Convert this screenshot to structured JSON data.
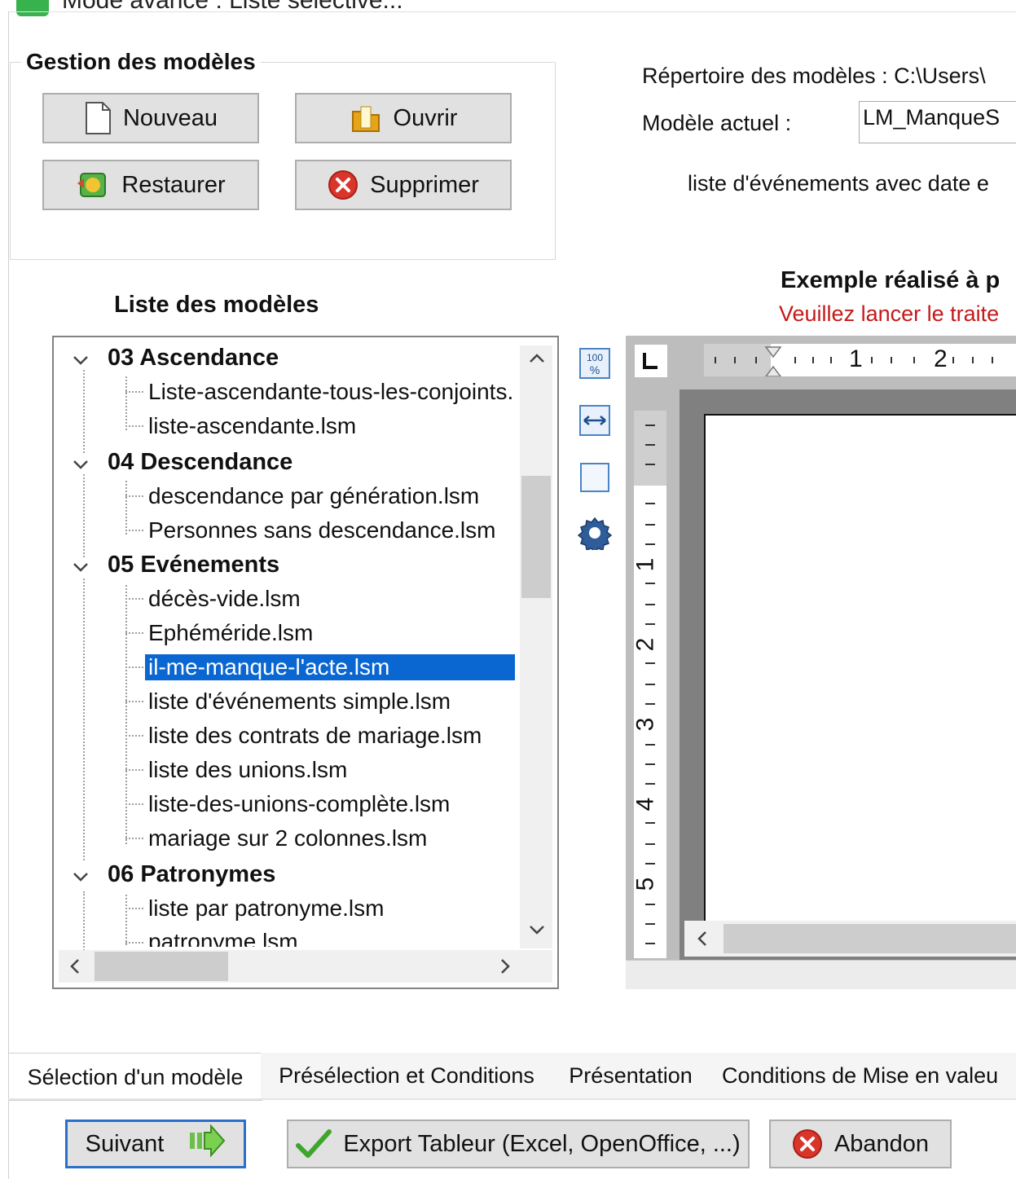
{
  "window": {
    "title": "Mode avancé : Liste sélective..."
  },
  "gestion": {
    "legend": "Gestion des modèles",
    "nouveau": "Nouveau",
    "ouvrir": "Ouvrir",
    "restaurer": "Restaurer",
    "supprimer": "Supprimer"
  },
  "info": {
    "repertoire_label": "Répertoire des modèles : C:\\Users\\",
    "modele_label": "Modèle actuel :",
    "modele_value": "LM_ManqueS",
    "description": "liste d'événements avec date e"
  },
  "exemple": {
    "title": "Exemple réalisé à p",
    "warning": "Veuillez lancer le traite"
  },
  "liste": {
    "title": "Liste des modèles",
    "groups": [
      {
        "label": "03 Ascendance",
        "items": [
          "Liste-ascendante-tous-les-conjoints.",
          "liste-ascendante.lsm"
        ]
      },
      {
        "label": "04 Descendance",
        "items": [
          "descendance par génération.lsm",
          "Personnes sans descendance.lsm"
        ]
      },
      {
        "label": "05 Evénements",
        "items": [
          "décès-vide.lsm",
          "Ephéméride.lsm",
          "il-me-manque-l'acte.lsm",
          "liste d'événements simple.lsm",
          "liste des contrats de mariage.lsm",
          "liste des unions.lsm",
          "liste-des-unions-complète.lsm",
          "mariage sur 2 colonnes.lsm"
        ]
      },
      {
        "label": "06 Patronymes",
        "items": [
          "liste par patronyme.lsm",
          "patronyme.lsm"
        ]
      }
    ],
    "selected": "il-me-manque-l'acte.lsm"
  },
  "ruler": {
    "h_ticks": [
      "1",
      "2"
    ],
    "v_ticks": [
      "1",
      "2",
      "3",
      "4",
      "5"
    ]
  },
  "tabs": [
    "Sélection d'un modèle",
    "Présélection et Conditions",
    "Présentation",
    "Conditions de Mise en valeu"
  ],
  "footer": {
    "suivant": "Suivant",
    "export": "Export Tableur (Excel, OpenOffice, ...)",
    "abandon": "Abandon"
  },
  "colors": {
    "selection": "#0a66d0",
    "warning": "#c41a1a",
    "button_face": "#e1e1e1"
  }
}
